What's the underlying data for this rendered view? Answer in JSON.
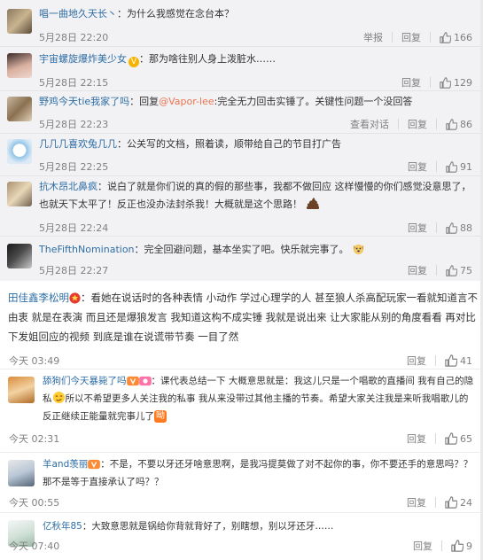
{
  "comments": [
    {
      "user": "唱一曲地久天长丶",
      "text": "：为什么我感觉在念台本？",
      "time": "5月28日 22:20",
      "report": "举报",
      "reply": "回复",
      "likes": "166"
    },
    {
      "user": "宇宙螺旋爆炸美少女",
      "text": "：那为啥往别人身上泼脏水……",
      "time": "5月28日 22:15",
      "reply": "回复",
      "likes": "129"
    },
    {
      "user": "野鸡今天tie我家了吗",
      "text_prefix": "：回复",
      "mention": "@Vapor-lee",
      "text_suffix": ":完全无力回击实锤了。关键性问题一个没回答",
      "time": "5月28日 22:23",
      "view_convo": "查看对话",
      "reply": "回复",
      "likes": "86"
    },
    {
      "user": "几几几喜欢兔几几",
      "text": "：公关写的文档，照着读，顺带给自己的节目打广告",
      "time": "5月28日 22:25",
      "reply": "回复",
      "likes": "91"
    },
    {
      "user": "抗木昂北鼻疯",
      "text": "：说白了就是你们说的真的假的那些事，我都不做回应 这样慢慢的你们感觉没意思了，也就天下太平了！反正也没办法封杀我！大概就是这个思路！",
      "time": "5月28日 22:24",
      "reply": "回复",
      "likes": "88"
    },
    {
      "user": "TheFifthNomination",
      "text": "：完全回避问题，基本坐实了吧。快乐就完事了。",
      "time": "5月28日 22:27",
      "reply": "回复",
      "likes": "75"
    },
    {
      "user": "田佳鑫李松明",
      "text": "：看她在说话时的各种表情 小动作 学过心理学的人 甚至狼人杀高配玩家一看就知道言不由衷 就是在表演 而且还是爆狼发言 我知道这构不成实锤 我就是说出来 让大家能从别的角度看看 再对比下发姐回应的视频 到底是谁在说谎带节奏 一目了然",
      "time": "今天 03:49",
      "reply": "回复",
      "likes": "41"
    },
    {
      "user": "舔狗们今天暴毙了吗",
      "text_prefix": "：课代表总结一下 大概意思就是：我这儿只是一个唱歌的直播间 我有自己的隐私",
      "text_suffix": "所以不希望更多人关注我的私事 我从来没带过其他主播的节奏。希望大家关注我是来听我唱歌儿的 反正继续正能量就完事儿了",
      "tag": "呦",
      "time": "今天 02:31",
      "reply": "回复",
      "likes": "65"
    },
    {
      "user": "羊and羡丽",
      "text": "：不是，不要以牙还牙啥意思啊，是我冯提莫做了对不起你的事，你不要还手的意思吗？？那不是等于直接承认了吗？？",
      "time": "今天 00:55",
      "reply": "回复",
      "likes": "24"
    },
    {
      "user": "亿秋年85",
      "text": "：大致意思就是锅给你背就背好了，别瞎想，别以牙还牙……",
      "time": "今天 07:40",
      "reply": "回复",
      "likes": "9"
    }
  ]
}
